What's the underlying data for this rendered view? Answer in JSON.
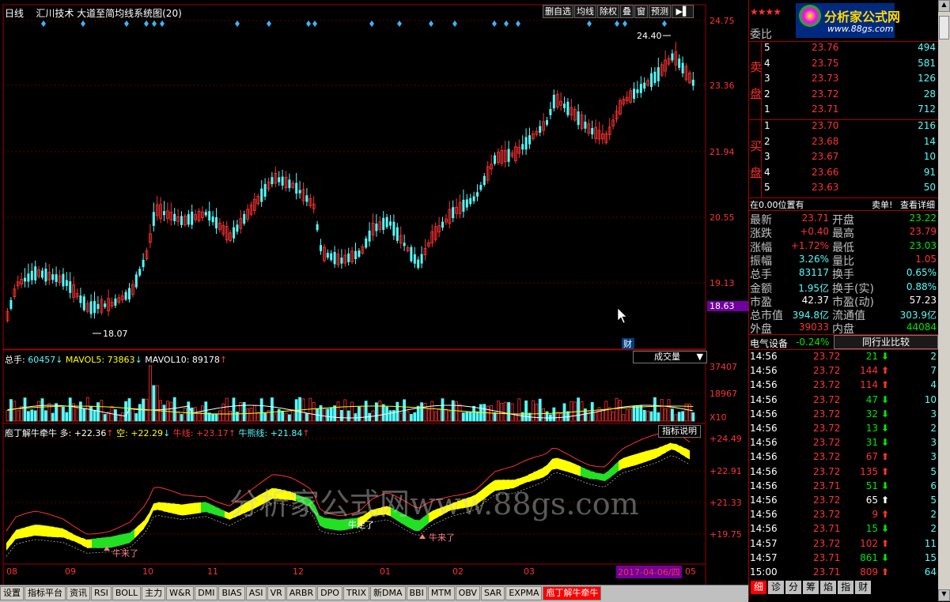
{
  "colors": {
    "up": "#ff3232",
    "down": "#54fcfc",
    "axis": "#ff3232",
    "bg": "#000000",
    "accent": "#ff0000"
  },
  "header": {
    "period": "日线",
    "title": "汇川技术 大道至简均线系统图(20)",
    "buttons": [
      "删自选",
      "均线",
      "除权",
      "叠",
      "窗",
      "预测"
    ],
    "arrow_icon": "arrow-right-icon"
  },
  "main": {
    "price_axis": [
      "24.75",
      "23.36",
      "21.94",
      "20.55",
      "19.13",
      "18.63"
    ],
    "high_label": "24.40",
    "low_label": "18.07",
    "finance_marker": "财"
  },
  "volume": {
    "title_prefix": "总手: ",
    "total": "60457",
    "arrow1": "↓",
    "mavol5_label": "MAVOL5: ",
    "mavol5": "73863",
    "arrow2": "↓",
    "mavol10_label": "MAVOL10: ",
    "mavol10": "89178",
    "arrow3": "↑",
    "dropdown": "成交量",
    "axis": [
      "37407",
      "18967",
      "X10"
    ]
  },
  "indicator": {
    "name": "庖丁解牛牵牛",
    "duo_label": "多: ",
    "duo": "+22.36",
    "duo_arrow": "↑",
    "kong_label": "空: ",
    "kong": "+22.29",
    "kong_arrow": "↓",
    "niu_label": "牛线: ",
    "niu": "+23.17",
    "niu_arrow": "↑",
    "niuxiong_label": "牛熊线: ",
    "niuxiong": "+21.84",
    "niuxiong_arrow": "↑",
    "help_button": "指标说明",
    "axis": [
      "+24.49",
      "+22.91",
      "+21.33",
      "+19.75"
    ],
    "labels": [
      "牛来了",
      "牛走了",
      "牛来了"
    ]
  },
  "watermark": "分析家公式网www.88gs.com",
  "date_axis": [
    "08",
    "09",
    "10",
    "11",
    "12",
    "01",
    "02",
    "03",
    "05"
  ],
  "date_highlight": "2017-04-06/四",
  "bottom_tabs": [
    "设置",
    "指标平台",
    "资讯",
    "RSI",
    "BOLL",
    "主力",
    "W&R",
    "DMI",
    "BIAS",
    "ASI",
    "VR",
    "ARBR",
    "DPO",
    "TRIX",
    "新DMA",
    "BBI",
    "MTM",
    "OBV",
    "SAR",
    "EXPMA",
    "庖丁解牛牵牛"
  ],
  "right": {
    "logo_text": "分析家公式网",
    "logo_url_text": "www.88gs.com",
    "weibi_label": "委比",
    "sell_label": [
      "卖",
      "盘"
    ],
    "buy_label": [
      "买",
      "盘"
    ],
    "sell": [
      {
        "n": "5",
        "p": "23.76",
        "v": "494"
      },
      {
        "n": "4",
        "p": "23.75",
        "v": "581"
      },
      {
        "n": "3",
        "p": "23.73",
        "v": "126"
      },
      {
        "n": "2",
        "p": "23.72",
        "v": "28"
      },
      {
        "n": "1",
        "p": "23.71",
        "v": "712"
      }
    ],
    "buy": [
      {
        "n": "1",
        "p": "23.70",
        "v": "216"
      },
      {
        "n": "2",
        "p": "23.68",
        "v": "14"
      },
      {
        "n": "3",
        "p": "23.67",
        "v": "10"
      },
      {
        "n": "4",
        "p": "23.66",
        "v": "91"
      },
      {
        "n": "5",
        "p": "23.63",
        "v": "50"
      }
    ],
    "pos_text": "在0.00位置有",
    "sell_single": "卖单!",
    "detail_link": "查看详细",
    "stats": [
      {
        "l1": "最新",
        "v1": "23.71",
        "c1": "red",
        "l2": "开盘",
        "v2": "23.22",
        "c2": "green"
      },
      {
        "l1": "涨跌",
        "v1": "+0.40",
        "c1": "red",
        "l2": "最高",
        "v2": "23.79",
        "c2": "red"
      },
      {
        "l1": "涨幅",
        "v1": "+1.72%",
        "c1": "red",
        "l2": "最低",
        "v2": "23.03",
        "c2": "green"
      },
      {
        "l1": "振幅",
        "v1": "3.26%",
        "c1": "cyan",
        "l2": "量比",
        "v2": "1.05",
        "c2": "red"
      },
      {
        "l1": "总手",
        "v1": "83117",
        "c1": "cyan",
        "l2": "换手",
        "v2": "0.65%",
        "c2": "cyan"
      },
      {
        "l1": "金额",
        "v1": "1.95亿",
        "c1": "cyan",
        "l2": "换手(实)",
        "v2": "0.88%",
        "c2": "cyan"
      },
      {
        "l1": "市盈",
        "v1": "42.37",
        "c1": "white",
        "l2": "市盈(动)",
        "v2": "57.23",
        "c2": "white"
      },
      {
        "l1": "总市值",
        "v1": "394.8亿",
        "c1": "cyan",
        "l2": "流通值",
        "v2": "303.9亿",
        "c2": "cyan"
      },
      {
        "l1": "外盘",
        "v1": "39033",
        "c1": "red",
        "l2": "内盘",
        "v2": "44084",
        "c2": "green"
      }
    ],
    "sector": "电气设备",
    "sector_change": "-0.24%",
    "compare_button": "同行业比较",
    "ticks": [
      {
        "t": "14:56",
        "p": "23.72",
        "v": "21",
        "d": "down",
        "n": "2"
      },
      {
        "t": "14:56",
        "p": "23.72",
        "v": "144",
        "d": "up",
        "n": "7"
      },
      {
        "t": "14:56",
        "p": "23.72",
        "v": "114",
        "d": "up",
        "n": "4"
      },
      {
        "t": "14:56",
        "p": "23.72",
        "v": "47",
        "d": "down",
        "n": "10"
      },
      {
        "t": "14:56",
        "p": "23.72",
        "v": "32",
        "d": "down",
        "n": "3"
      },
      {
        "t": "14:56",
        "p": "23.72",
        "v": "13",
        "d": "down",
        "n": "2"
      },
      {
        "t": "14:56",
        "p": "23.72",
        "v": "31",
        "d": "down",
        "n": "3"
      },
      {
        "t": "14:56",
        "p": "23.72",
        "v": "67",
        "d": "up",
        "n": "3"
      },
      {
        "t": "14:56",
        "p": "23.72",
        "v": "135",
        "d": "up",
        "n": "5"
      },
      {
        "t": "14:56",
        "p": "23.71",
        "v": "51",
        "d": "down",
        "n": "6"
      },
      {
        "t": "14:56",
        "p": "23.72",
        "v": "65",
        "d": "neutral",
        "n": "5"
      },
      {
        "t": "14:56",
        "p": "23.72",
        "v": "9",
        "d": "up",
        "n": "2"
      },
      {
        "t": "14:56",
        "p": "23.71",
        "v": "15",
        "d": "down",
        "n": "2"
      },
      {
        "t": "14:57",
        "p": "23.72",
        "v": "102",
        "d": "up",
        "n": "11"
      },
      {
        "t": "14:57",
        "p": "23.71",
        "v": "861",
        "d": "down",
        "n": "15"
      },
      {
        "t": "15:00",
        "p": "23.71",
        "v": "809",
        "d": "up",
        "n": "64"
      }
    ],
    "tabs": [
      "细",
      "诊",
      "分",
      "筹",
      "焰",
      "指",
      "财"
    ]
  }
}
